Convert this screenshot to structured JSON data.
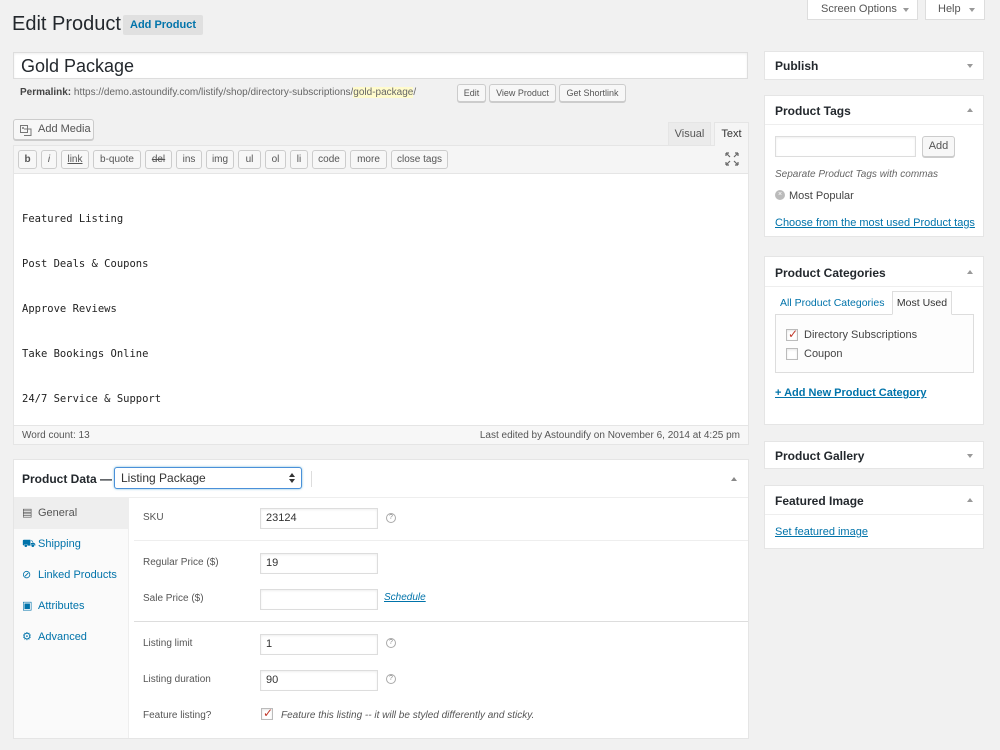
{
  "header": {
    "title": "Edit Product",
    "add_button": "Add Product",
    "screen_options": "Screen Options",
    "help": "Help"
  },
  "product": {
    "title": "Gold Package",
    "permalink_label": "Permalink:",
    "permalink_base": "https://demo.astoundify.com/listify/shop/directory-subscriptions/",
    "permalink_slug": "gold-package",
    "permalink_suffix": "/",
    "edit_btn": "Edit",
    "view_btn": "View Product",
    "shortlink_btn": "Get Shortlink"
  },
  "editor": {
    "add_media": "Add Media",
    "tab_visual": "Visual",
    "tab_text": "Text",
    "quicktags": [
      "b",
      "i",
      "link",
      "b-quote",
      "del",
      "ins",
      "img",
      "ul",
      "ol",
      "li",
      "code",
      "more",
      "close tags"
    ],
    "content": [
      "Featured Listing",
      "Post Deals & Coupons",
      "Approve Reviews",
      "Take Bookings Online",
      "24/7 Service & Support"
    ],
    "word_count": "Word count: 13",
    "last_edited": "Last edited by Astoundify on November 6, 2014 at 4:25 pm"
  },
  "product_data": {
    "label": "Product Data —",
    "type_selected": "Listing Package",
    "tabs": [
      {
        "icon": "list-icon",
        "label": "General"
      },
      {
        "icon": "truck-icon",
        "label": "Shipping"
      },
      {
        "icon": "link-icon",
        "label": "Linked Products"
      },
      {
        "icon": "table-icon",
        "label": "Attributes"
      },
      {
        "icon": "gear-icon",
        "label": "Advanced"
      }
    ],
    "sku_label": "SKU",
    "sku_value": "23124",
    "regular_price_label": "Regular Price ($)",
    "regular_price_value": "19",
    "sale_price_label": "Sale Price ($)",
    "sale_price_value": "",
    "schedule": "Schedule",
    "listing_limit_label": "Listing limit",
    "listing_limit_value": "1",
    "listing_duration_label": "Listing duration",
    "listing_duration_value": "90",
    "feature_label": "Feature listing?",
    "feature_checked": true,
    "feature_desc": "Feature this listing -- it will be styled differently and sticky."
  },
  "sidebar": {
    "publish_title": "Publish",
    "tags_title": "Product Tags",
    "tags_add": "Add",
    "tags_hint": "Separate Product Tags with commas",
    "tags_most_popular": "Most Popular",
    "tags_choose": "Choose from the most used Product tags",
    "categories_title": "Product Categories",
    "cat_tab_all": "All Product Categories",
    "cat_tab_most": "Most Used",
    "categories": [
      {
        "label": "Directory Subscriptions",
        "checked": true
      },
      {
        "label": "Coupon",
        "checked": false
      }
    ],
    "add_category": "+ Add New Product Category",
    "gallery_title": "Product Gallery",
    "featured_title": "Featured Image",
    "set_featured": "Set featured image"
  },
  "colors": {
    "link": "#0073aa",
    "check": "#c0392b",
    "slug_highlight": "#fffbcc"
  }
}
